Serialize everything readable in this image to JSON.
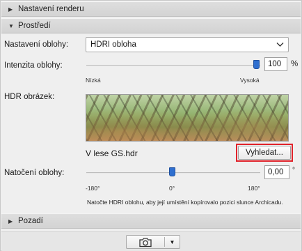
{
  "sections": {
    "render_settings": {
      "label": "Nastavení renderu",
      "expanded": false
    },
    "environment": {
      "label": "Prostředí",
      "expanded": true
    },
    "background": {
      "label": "Pozadí",
      "expanded": false
    }
  },
  "sky_settings": {
    "label": "Nastavení oblohy:",
    "value": "HDRI obloha"
  },
  "sky_intensity": {
    "label": "Intenzita oblohy:",
    "value": "100",
    "unit": "%",
    "min_label": "Nízká",
    "max_label": "Vysoká",
    "level_fraction": 1.0
  },
  "hdr_image": {
    "label": "HDR obrázek:",
    "filename": "V lese GS.hdr",
    "browse_label": "Vyhledat..."
  },
  "sky_rotation": {
    "label": "Natočení oblohy:",
    "value": "0,00",
    "unit": "°",
    "ticks": [
      "-180°",
      "0°",
      "180°"
    ],
    "hint": "Natočte HDRI oblohu, aby její umístění kopírovalo pozici slunce Archicadu."
  },
  "footer": {
    "camera_icon": "camera-icon",
    "menu_icon": "triangle-down-icon"
  },
  "colors": {
    "accent": "#2f6fcf",
    "highlight_border": "#e0222a"
  }
}
